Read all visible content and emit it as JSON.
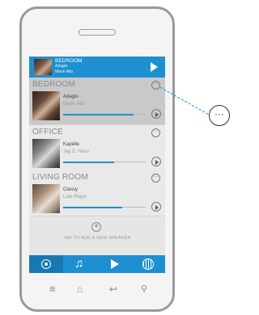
{
  "now_playing": {
    "room": "BEDROOM",
    "song": "Adagio",
    "artist": "Marie Alto"
  },
  "speakers": [
    {
      "room": "BEDROOM",
      "song": "Adagio",
      "artist": "Marie Alto",
      "progress": 0.85
    },
    {
      "room": "OFFICE",
      "song": "Kapelle",
      "artist": "Jay Z. Hans",
      "progress": 0.62
    },
    {
      "room": "LIVING ROOM",
      "song": "Classy",
      "artist": "Lute Playa",
      "progress": 0.72
    }
  ],
  "add_speaker": {
    "label": "TAP TO ADD A NEW SPEAKER"
  },
  "tabs": [
    {
      "icon": "speakers-icon"
    },
    {
      "icon": "music-note-icon"
    },
    {
      "icon": "play-icon"
    },
    {
      "icon": "radio-icon"
    }
  ],
  "glyphs": {
    "more": "···",
    "add": "+",
    "music_note": "♫",
    "menu": "≡",
    "home": "⌂",
    "back": "↩",
    "search": "⚲",
    "callout": "···"
  },
  "colors": {
    "accent": "#1e8fd0",
    "active_tab": "#1679b3",
    "selected_card": "#c9c9c9"
  }
}
